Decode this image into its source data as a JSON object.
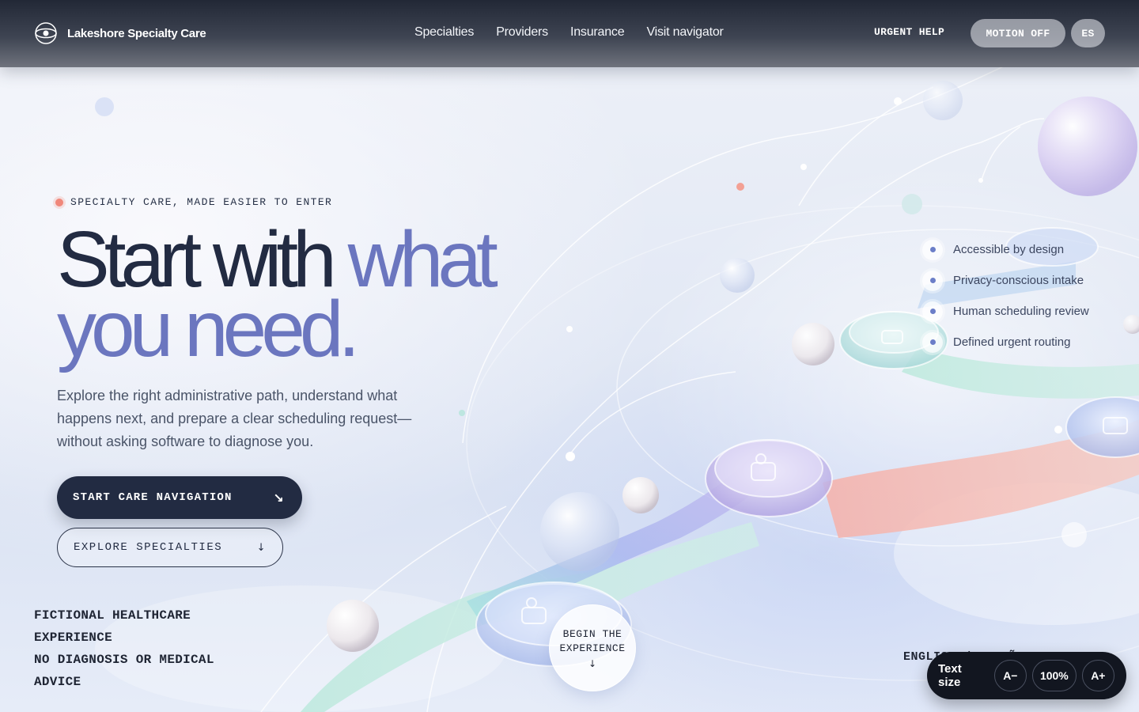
{
  "header": {
    "brand_name": "Lakeshore Specialty Care",
    "nav": [
      "Specialties",
      "Providers",
      "Insurance",
      "Visit navigator"
    ],
    "urgent_help": "URGENT HELP",
    "motion_toggle": "MOTION OFF",
    "language_toggle": "ES"
  },
  "hero": {
    "eyebrow": "SPECIALTY CARE, MADE EASIER TO ENTER",
    "headline_plain": "Start with ",
    "headline_accent_1": "what",
    "headline_accent_2": "you need.",
    "lede": "Explore the right administrative path, understand what happens next, and prepare a clear scheduling request—without asking software to diagnose you.",
    "primary_cta": "START CARE NAVIGATION",
    "primary_cta_icon": "↘",
    "secondary_cta": "EXPLORE SPECIALTIES",
    "secondary_cta_icon": "↓"
  },
  "disclaimer": {
    "line1": "FICTIONAL HEALTHCARE",
    "line2": "EXPERIENCE",
    "line3": "NO DIAGNOSIS OR MEDICAL",
    "line4": "ADVICE"
  },
  "features": [
    "Accessible by design",
    "Privacy-conscious intake",
    "Human scheduling review",
    "Defined urgent routing"
  ],
  "begin": {
    "label": "BEGIN THE EXPERIENCE",
    "arrow": "↓"
  },
  "language_line": "ENGLISH / ESPAÑOL MENU",
  "text_size": {
    "label": "Text size",
    "decrease": "A−",
    "value": "100%",
    "increase": "A+"
  },
  "colors": {
    "ink": "#222b42",
    "accent": "#6b76bf",
    "eyebrow_dot": "#f0877a",
    "header_dark": "#222836"
  }
}
